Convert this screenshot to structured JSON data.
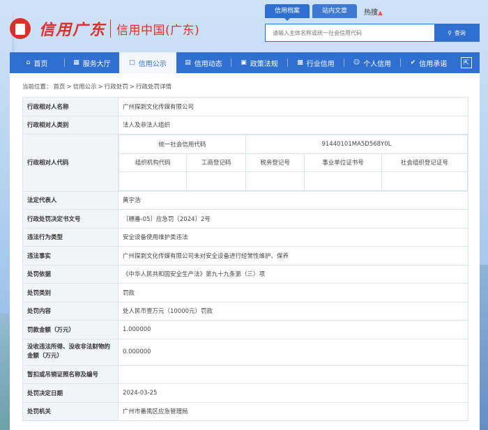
{
  "header": {
    "logo_script": "信用广东",
    "logo_text": "信用中国(广东)",
    "search_tabs": [
      "信用档案",
      "站内文章"
    ],
    "hot_label": "热搜",
    "search_placeholder": "请输入主体名称或统一社会信用代码",
    "search_button": "查询"
  },
  "nav": {
    "items": [
      {
        "label": "首页",
        "icon": "home-icon"
      },
      {
        "label": "服务大厅",
        "icon": "services-icon"
      },
      {
        "label": "信用公示",
        "icon": "publicity-icon"
      },
      {
        "label": "信用动态",
        "icon": "news-icon"
      },
      {
        "label": "政策法规",
        "icon": "policy-icon"
      },
      {
        "label": "行业信用",
        "icon": "industry-icon"
      },
      {
        "label": "个人信用",
        "icon": "person-icon"
      },
      {
        "label": "信用承诺",
        "icon": "promise-icon"
      }
    ],
    "active_index": 2,
    "accent": "#2f6fd0"
  },
  "breadcrumb": {
    "prefix": "当前位置：",
    "items": [
      "首页",
      "信用公示",
      "行政处罚",
      "行政处罚详情"
    ],
    "sep": ">"
  },
  "detail": {
    "name_label": "行政相对人名称",
    "name_value": "广州探剥文化传媒有限公司",
    "type_label": "行政相对人类别",
    "type_value": "法人及非法人组织",
    "code_label": "行政相对人代码",
    "uscc_label": "统一社会信用代码",
    "uscc_value": "91440101MA5D568Y0L",
    "code_headers": [
      "组织机构代码",
      "工商登记码",
      "税务登记号",
      "事业单位证书号",
      "社会组织登记证号"
    ],
    "code_values": [
      "",
      "",
      "",
      "",
      ""
    ],
    "rows": [
      {
        "label": "法定代表人",
        "value": "黄宇浩"
      },
      {
        "label": "行政处罚决定书文号",
        "value": "〔穗番-05〕应急罚〔2024〕2号"
      },
      {
        "label": "违法行为类型",
        "value": "安全设备使用维护类违法"
      },
      {
        "label": "违法事实",
        "value": "广州探剥文化传媒有限公司未对安全设备进行经常性维护、保养"
      },
      {
        "label": "处罚依据",
        "value": "《中华人民共和国安全生产法》第九十九条第（三）项"
      },
      {
        "label": "处罚类别",
        "value": "罚款"
      },
      {
        "label": "处罚内容",
        "value": "处人民币壹万元（10000元）罚款"
      },
      {
        "label": "罚款金额（万元）",
        "value": "1.000000"
      },
      {
        "label": "没收违法所得、没收非法财物的金额（万元）",
        "value": "0.000000",
        "tall": true
      },
      {
        "label": "暂扣或吊销证照名称及编号",
        "value": ""
      },
      {
        "label": "处罚决定日期",
        "value": "2024-03-25"
      },
      {
        "label": "处罚机关",
        "value": "广州市番禺区应急管理局"
      }
    ]
  }
}
